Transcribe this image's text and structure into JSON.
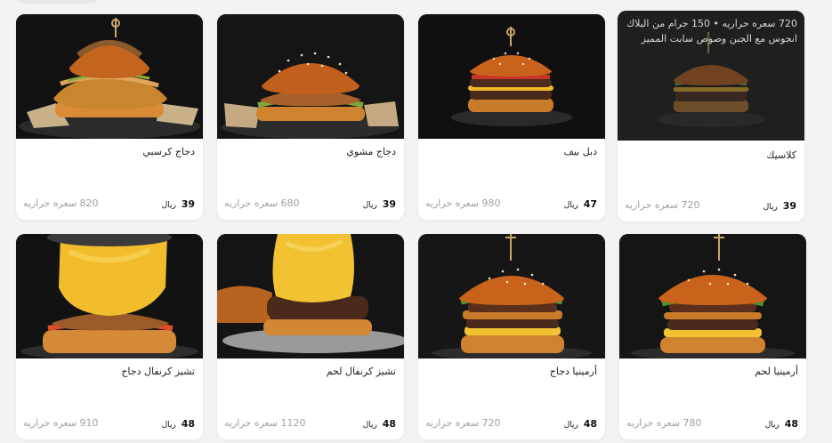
{
  "currency": "ريال",
  "products": [
    {
      "name": "دجاج كرسبي",
      "price": "39",
      "calories": "820 سعره حراريه",
      "image": "crispy-chicken-burger",
      "hover_text": ""
    },
    {
      "name": "دجاج مشوي",
      "price": "39",
      "calories": "680 سعره حراريه",
      "image": "grilled-chicken-burger",
      "hover_text": ""
    },
    {
      "name": "دبل بيف",
      "price": "47",
      "calories": "980 سعره حراريه",
      "image": "double-beef-burger",
      "hover_text": ""
    },
    {
      "name": "كلاسيك",
      "price": "39",
      "calories": "720 سعره حراريه",
      "image": "classic-burger",
      "hover_text": "720 سعره حراريه • 150 جرام من البلاك انجوس مع الجبن وصوص سابت المميز"
    },
    {
      "name": "تشيز كرنفال دجاج",
      "price": "48",
      "calories": "910 سعره حراريه",
      "image": "cheese-carnival-chicken-burger",
      "hover_text": ""
    },
    {
      "name": "تشيز كرنفال لحم",
      "price": "48",
      "calories": "1120 سعره حراريه",
      "image": "cheese-carnival-beef-burger",
      "hover_text": ""
    },
    {
      "name": "أرمينيا دجاج",
      "price": "48",
      "calories": "720 سعره حراريه",
      "image": "armenia-chicken-burger",
      "hover_text": ""
    },
    {
      "name": "أرمينيا لحم",
      "price": "48",
      "calories": "780 سعره حراريه",
      "image": "armenia-beef-burger",
      "hover_text": ""
    }
  ]
}
